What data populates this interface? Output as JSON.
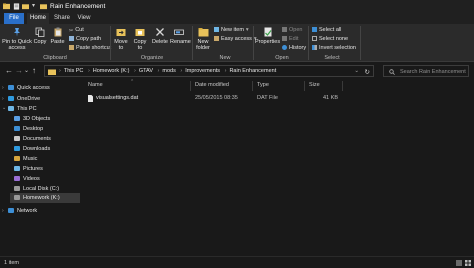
{
  "window": {
    "title": "Rain Enhancement"
  },
  "tabs": [
    {
      "label": "File"
    },
    {
      "label": "Home"
    },
    {
      "label": "Share"
    },
    {
      "label": "View"
    }
  ],
  "ribbon": {
    "clipboard": {
      "pin_label": "Pin to Quick access",
      "copy_label": "Copy",
      "paste_label": "Paste",
      "cut_label": "Cut",
      "copy_path_label": "Copy path",
      "paste_shortcut_label": "Paste shortcut",
      "group_label": "Clipboard"
    },
    "organize": {
      "move_to_label": "Move to",
      "copy_to_label": "Copy to",
      "delete_label": "Delete",
      "rename_label": "Rename",
      "group_label": "Organize"
    },
    "new": {
      "new_folder_label": "New folder",
      "new_item_label": "New item",
      "easy_access_label": "Easy access",
      "group_label": "New"
    },
    "open": {
      "properties_label": "Properties",
      "open_label": "Open",
      "edit_label": "Edit",
      "history_label": "History",
      "group_label": "Open"
    },
    "select": {
      "select_all_label": "Select all",
      "select_none_label": "Select none",
      "invert_selection_label": "Invert selection",
      "group_label": "Select"
    }
  },
  "address": {
    "crumbs": [
      "This PC",
      "Homework (K:)",
      "GTAV",
      "mods",
      "Improvements",
      "Rain Enhancement"
    ],
    "search_placeholder": "Search Rain Enhancement"
  },
  "nav": {
    "quick_access": "Quick access",
    "onedrive": "OneDrive",
    "this_pc": "This PC",
    "items": [
      {
        "label": "3D Objects",
        "icon": "3d-objects-icon",
        "color": "#5aa0e6"
      },
      {
        "label": "Desktop",
        "icon": "desktop-icon",
        "color": "#3d8fd6"
      },
      {
        "label": "Documents",
        "icon": "documents-icon",
        "color": "#c9c9c9"
      },
      {
        "label": "Downloads",
        "icon": "downloads-icon",
        "color": "#2f9be0"
      },
      {
        "label": "Music",
        "icon": "music-icon",
        "color": "#d6a53d"
      },
      {
        "label": "Pictures",
        "icon": "pictures-icon",
        "color": "#6fb7e6"
      },
      {
        "label": "Videos",
        "icon": "videos-icon",
        "color": "#9a6fd6"
      },
      {
        "label": "Local Disk (C:)",
        "icon": "drive-icon",
        "color": "#9a9a9a"
      },
      {
        "label": "Homework (K:)",
        "icon": "drive-icon",
        "color": "#9a9a9a"
      }
    ],
    "network": "Network"
  },
  "columns": {
    "name": "Name",
    "date": "Date modified",
    "type": "Type",
    "size": "Size"
  },
  "files": [
    {
      "name": "visualsettings.dat",
      "date": "25/05/2015 08:35",
      "type": "DAT File",
      "size": "41 KB"
    }
  ],
  "status": {
    "text": "1 item"
  },
  "colors": {
    "accent": "#2a6fc9",
    "folder": "#e8c25a",
    "background": "#191919",
    "ribbon": "#2b2b2b"
  }
}
